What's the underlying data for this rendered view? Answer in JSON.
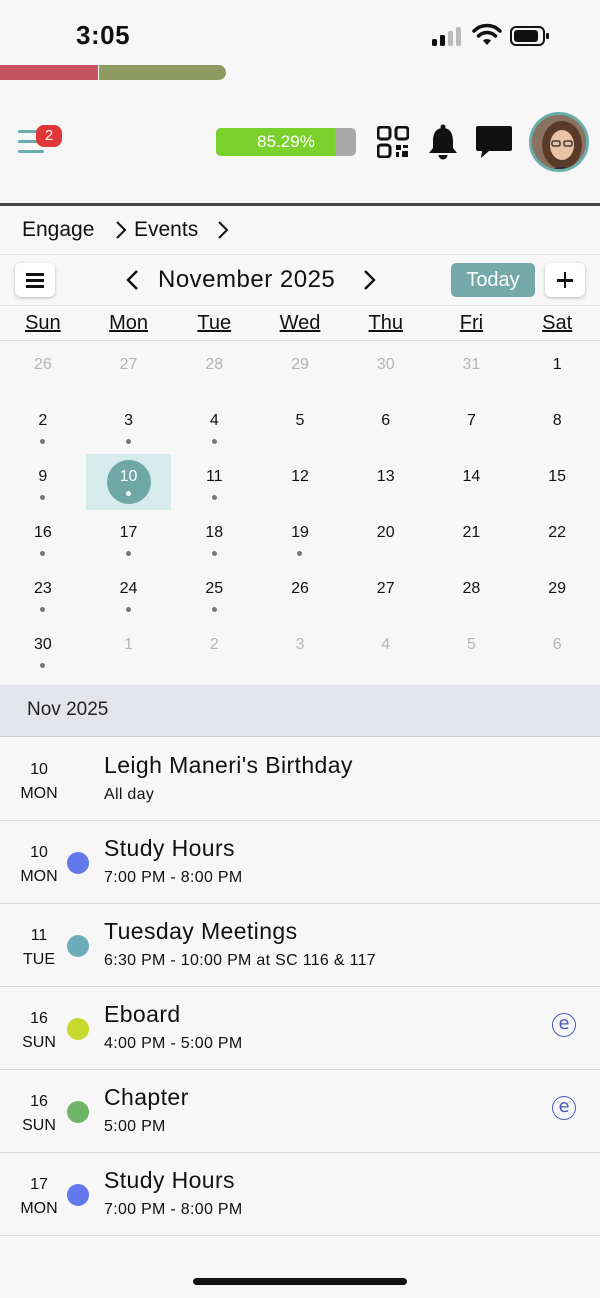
{
  "status_bar": {
    "time": "3:05"
  },
  "header": {
    "notification_count": "2",
    "points_progress": 0.8529,
    "points_label": "85.29%",
    "icons": [
      "menu-icon",
      "qr-code-icon",
      "bell-icon",
      "chat-icon"
    ]
  },
  "breadcrumb": {
    "items": [
      "Engage",
      "Events"
    ]
  },
  "calendar": {
    "month_title": "November 2025",
    "today_label": "Today",
    "weekdays": [
      "Sun",
      "Mon",
      "Tue",
      "Wed",
      "Thu",
      "Fri",
      "Sat"
    ],
    "weeks": [
      [
        {
          "d": "26",
          "m": true
        },
        {
          "d": "27",
          "m": true
        },
        {
          "d": "28",
          "m": true
        },
        {
          "d": "29",
          "m": true
        },
        {
          "d": "30",
          "m": true
        },
        {
          "d": "31",
          "m": true
        },
        {
          "d": "1"
        }
      ],
      [
        {
          "d": "2",
          "dot": true
        },
        {
          "d": "3",
          "dot": true
        },
        {
          "d": "4",
          "dot": true
        },
        {
          "d": "5"
        },
        {
          "d": "6"
        },
        {
          "d": "7"
        },
        {
          "d": "8"
        }
      ],
      [
        {
          "d": "9",
          "dot": true
        },
        {
          "d": "10",
          "dot": true,
          "sel": true
        },
        {
          "d": "11",
          "dot": true
        },
        {
          "d": "12"
        },
        {
          "d": "13"
        },
        {
          "d": "14"
        },
        {
          "d": "15"
        }
      ],
      [
        {
          "d": "16",
          "dot": true
        },
        {
          "d": "17",
          "dot": true
        },
        {
          "d": "18",
          "dot": true
        },
        {
          "d": "19",
          "dot": true
        },
        {
          "d": "20"
        },
        {
          "d": "21"
        },
        {
          "d": "22"
        }
      ],
      [
        {
          "d": "23",
          "dot": true
        },
        {
          "d": "24",
          "dot": true
        },
        {
          "d": "25",
          "dot": true
        },
        {
          "d": "26"
        },
        {
          "d": "27"
        },
        {
          "d": "28"
        },
        {
          "d": "29"
        }
      ],
      [
        {
          "d": "30",
          "dot": true
        },
        {
          "d": "1",
          "m": true
        },
        {
          "d": "2",
          "m": true
        },
        {
          "d": "3",
          "m": true
        },
        {
          "d": "4",
          "m": true
        },
        {
          "d": "5",
          "m": true
        },
        {
          "d": "6",
          "m": true
        }
      ]
    ]
  },
  "month_band": "Nov 2025",
  "events": [
    {
      "day": "10",
      "dow": "MON",
      "title": "Leigh Maneri's Birthday",
      "time": "All day",
      "color": "",
      "engage": false
    },
    {
      "day": "10",
      "dow": "MON",
      "title": "Study Hours",
      "time": "7:00 PM - 8:00 PM",
      "color": "#6278ec",
      "engage": false
    },
    {
      "day": "11",
      "dow": "TUE",
      "title": "Tuesday Meetings",
      "time": "6:30 PM - 10:00 PM at SC 116 & 117",
      "color": "#6eabbb",
      "engage": false
    },
    {
      "day": "16",
      "dow": "SUN",
      "title": "Eboard",
      "time": "4:00 PM - 5:00 PM",
      "color": "#c8d82c",
      "engage": true
    },
    {
      "day": "16",
      "dow": "SUN",
      "title": "Chapter",
      "time": "5:00 PM",
      "color": "#6fb467",
      "engage": true
    },
    {
      "day": "17",
      "dow": "MON",
      "title": "Study Hours",
      "time": "7:00 PM - 8:00 PM",
      "color": "#6278ec",
      "engage": false
    }
  ],
  "engage_icon_glyph": "e"
}
